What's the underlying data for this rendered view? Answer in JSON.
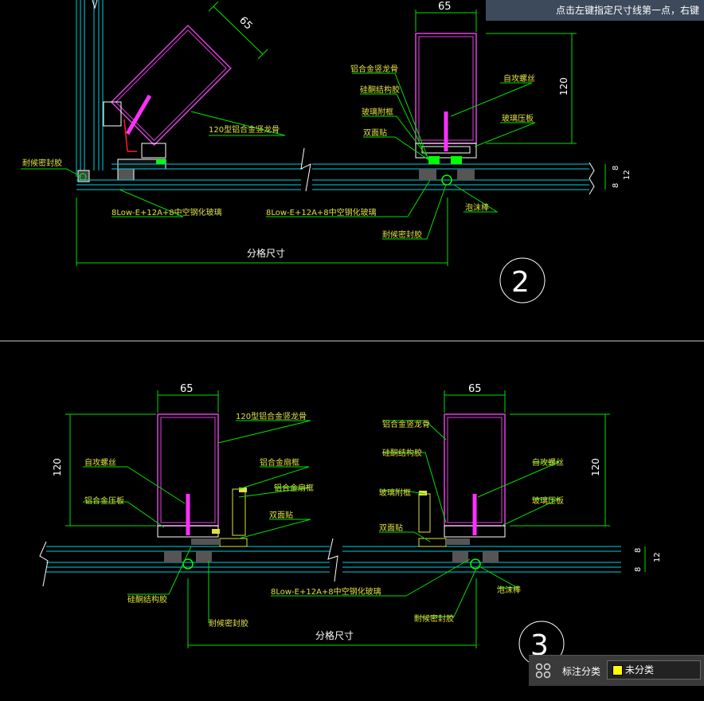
{
  "command_prompt": "点击左键指定尺寸线第一点，右键",
  "panel": {
    "label": "标注分类",
    "selected": "未分类",
    "swatch_color": "#ffff00",
    "icon": "grid-icon"
  },
  "colors": {
    "background": "#000000",
    "mullion": "#e040e0",
    "glass": "#00d0e0",
    "dim": "#00e000",
    "leader": "#00e000",
    "text": "#e0e040",
    "screw": "#ff30ff",
    "gasket_green": "#00ff00",
    "white": "#ffffff"
  },
  "top": {
    "dim_65_left": "65",
    "dim_65_right": "65",
    "dim_120": "120",
    "dim_8_a": "8",
    "dim_8_b": "8",
    "dim_12": "12",
    "label_frame_left": "120型铝合金竖龙骨",
    "label_mullion": "铝合金竖龙骨",
    "label_silicone": "硅酮结构胶",
    "label_glass_pad": "玻璃附框",
    "label_double_tape": "双面贴",
    "label_screw": "自攻螺丝",
    "label_pressure": "玻璃压板",
    "label_weather_left": "耐候密封胶",
    "label_glass_left": "8Low-E+12A+8中空钢化玻璃",
    "label_glass_right": "8Low-E+12A+8中空钢化玻璃",
    "label_foam": "泡沫棒",
    "label_weather_right": "耐候密封胶",
    "dim_grid": "分格尺寸",
    "circle_num": "2"
  },
  "bottom": {
    "dim_65_left": "65",
    "dim_65_right": "65",
    "dim_120_left": "120",
    "dim_120_right": "120",
    "dim_8_a": "8",
    "dim_8_b": "8",
    "dim_12": "12",
    "label_frame": "120型铝合金竖龙骨",
    "label_screw_left": "自攻螺丝",
    "label_pressure_left": "铝合金压板",
    "label_sash": "铝合金扇框",
    "label_sash2": "铝合金扇框",
    "label_double_tape_left": "双面贴",
    "label_silicone_left": "硅酮结构胶",
    "label_weather_left": "耐候密封胶",
    "label_glass": "8Low-E+12A+8中空钢化玻璃",
    "label_mullion_right": "铝合金竖龙骨",
    "label_silicone_right": "硅酮结构胶",
    "label_glass_pad_right": "玻璃附框",
    "label_double_tape_right": "双面贴",
    "label_screw_right": "自攻螺丝",
    "label_pressure_right": "玻璃压板",
    "label_foam": "泡沫棒",
    "label_weather_right": "耐候密封胶",
    "dim_grid": "分格尺寸",
    "circle_num": "3"
  }
}
